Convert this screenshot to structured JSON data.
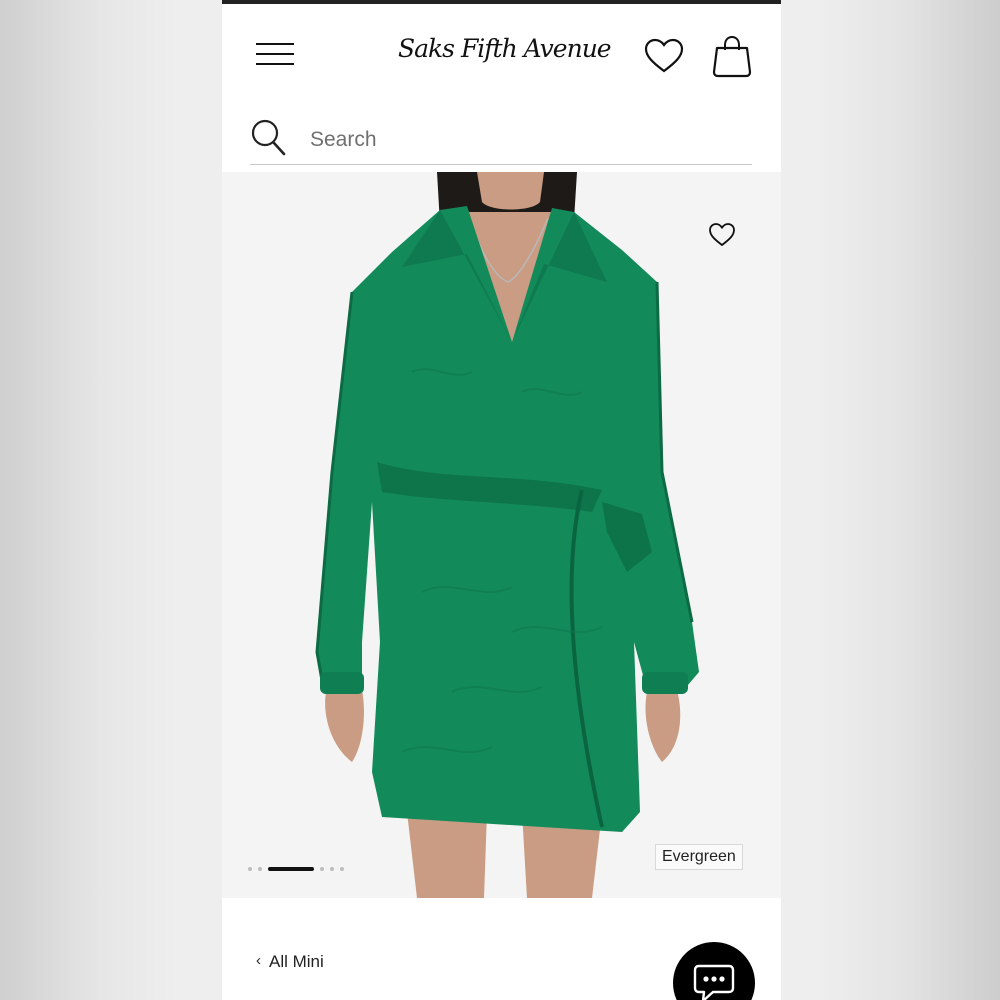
{
  "header": {
    "menu_icon": "hamburger-menu-icon",
    "brand": "Saks Fifth Avenue",
    "wishlist_icon": "heart-icon",
    "bag_icon": "shopping-bag-icon"
  },
  "search": {
    "placeholder": "Search",
    "icon": "search-icon"
  },
  "product_image": {
    "description_icon": "dress-photo",
    "favorite_icon": "heart-icon",
    "color_label": "Evergreen",
    "dress_color": "#138a5a",
    "gallery": {
      "total": 7,
      "active_index": 2
    }
  },
  "breadcrumb": {
    "label": "All Mini"
  },
  "chat": {
    "icon": "chat-bubble-icon"
  }
}
